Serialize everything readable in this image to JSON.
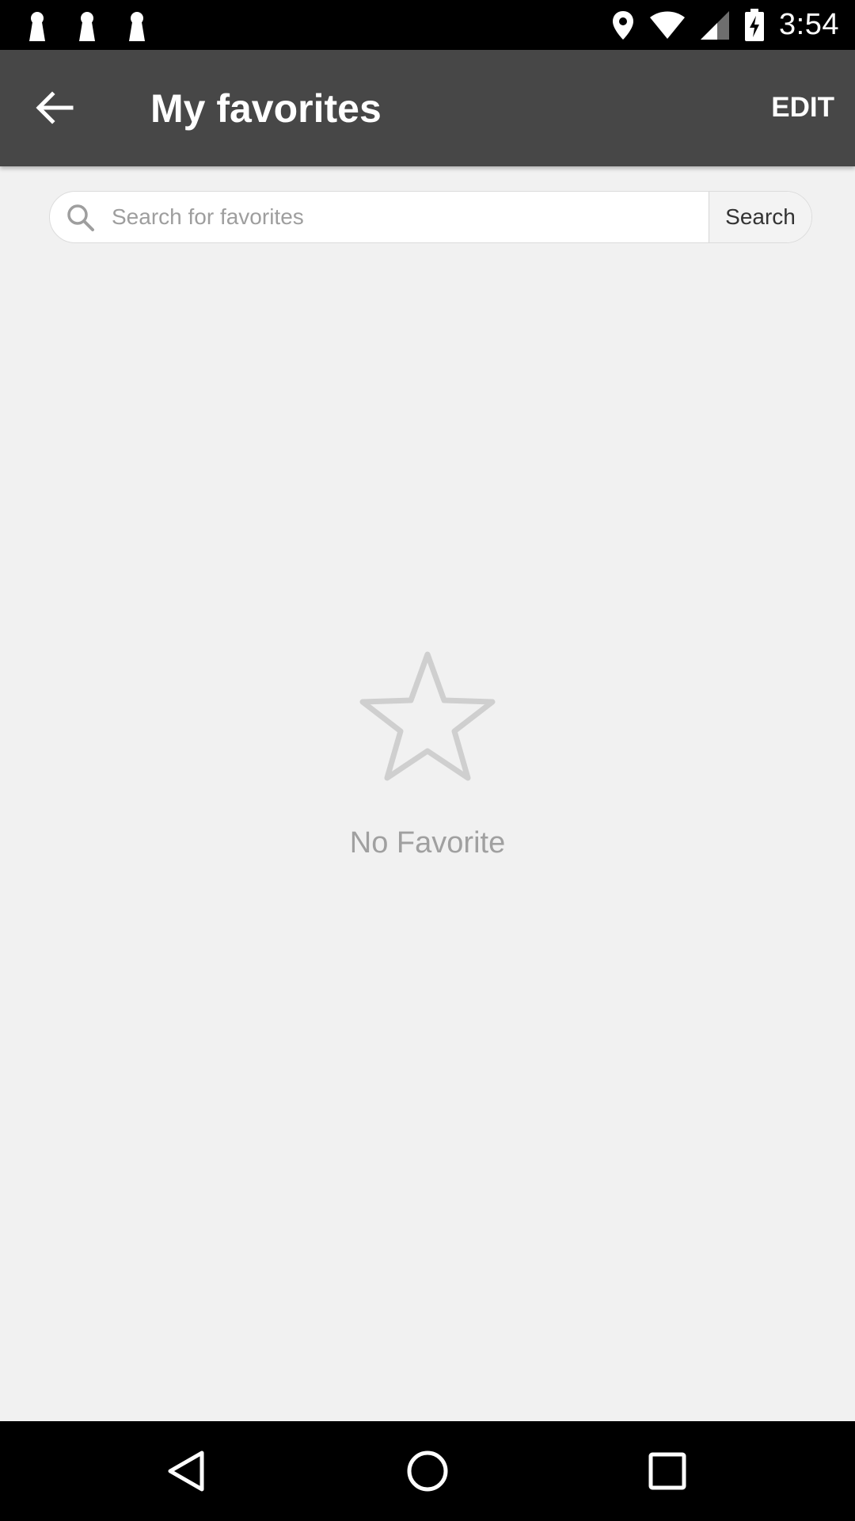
{
  "status_bar": {
    "time": "3:54",
    "notification_icons": [
      "keyhole-icon",
      "keyhole-icon",
      "keyhole-icon"
    ],
    "right_icons": [
      "location-icon",
      "wifi-icon",
      "cellular-signal-icon",
      "battery-charging-icon"
    ]
  },
  "app_bar": {
    "back_icon": "arrow-left-icon",
    "title": "My favorites",
    "edit_label": "EDIT"
  },
  "search": {
    "placeholder": "Search for favorites",
    "value": "",
    "button_label": "Search",
    "icon": "search-icon"
  },
  "empty_state": {
    "icon": "star-outline-icon",
    "message": "No Favorite"
  },
  "nav_bar": {
    "buttons": [
      "back-triangle-icon",
      "home-circle-icon",
      "recents-square-icon"
    ]
  },
  "colors": {
    "status_bar": "#000000",
    "app_bar": "#474747",
    "background": "#f1f1f1",
    "empty_text": "#a0a0a0",
    "star_outline": "#cfcfcf"
  }
}
